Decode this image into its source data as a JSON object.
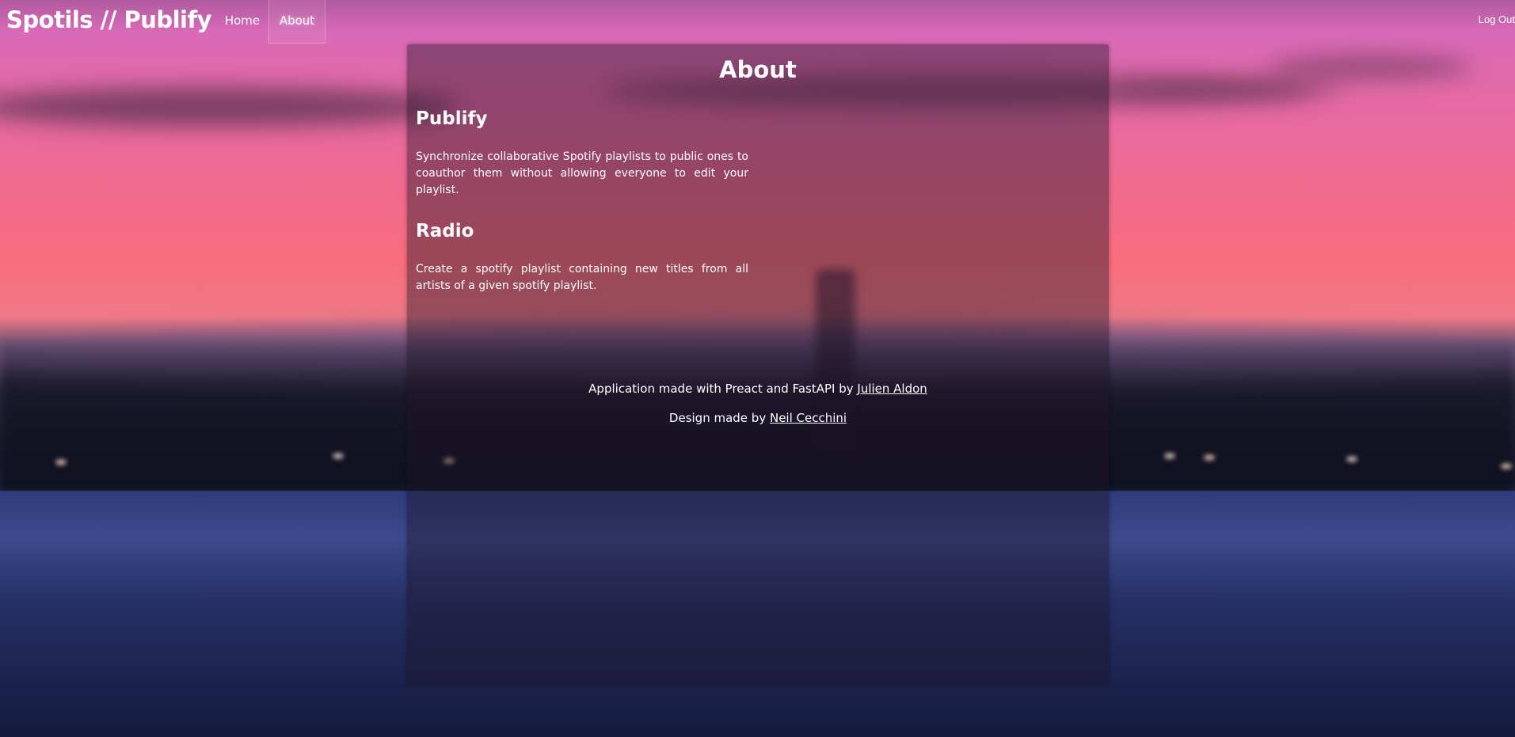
{
  "navbar": {
    "brand": "Spotils // Publify",
    "links": [
      {
        "label": "Home",
        "active": false
      },
      {
        "label": "About",
        "active": true
      }
    ],
    "logout_label": "Log Out"
  },
  "about": {
    "title": "About",
    "sections": [
      {
        "title": "Publify",
        "text": "Synchronize collaborative Spotify playlists to public ones to coauthor them without allowing everyone to edit your playlist."
      },
      {
        "title": "Radio",
        "text": "Create a spotify playlist containing new titles from all artists of a given spotify playlist."
      }
    ],
    "credits": {
      "app_prefix": "Application made with Preact and FastAPI by ",
      "app_author": "Julien Aldon",
      "design_prefix": "Design made by ",
      "design_author": "Neil Cecchini"
    }
  },
  "colors": {
    "text": "#ffffff",
    "card_overlay": "#1e1426"
  }
}
